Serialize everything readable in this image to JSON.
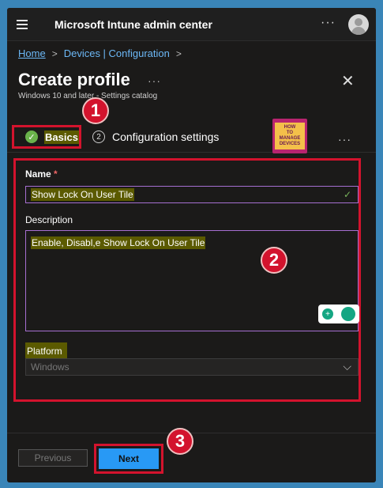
{
  "app": {
    "title": "Microsoft Intune admin center"
  },
  "breadcrumb": {
    "home": "Home",
    "item": "Devices | Configuration"
  },
  "page": {
    "title": "Create profile",
    "subtitle": "Windows 10 and later - Settings catalog"
  },
  "steps": [
    {
      "label": "Basics",
      "status": "complete"
    },
    {
      "number": "2",
      "label": "Configuration settings",
      "status": "pending"
    }
  ],
  "logo": {
    "lines": [
      "HOW",
      "TO",
      "MANAGE",
      "DEVICES"
    ]
  },
  "form": {
    "name": {
      "label": "Name",
      "required_mark": "*",
      "value": "Show Lock On User Tile"
    },
    "description": {
      "label": "Description",
      "value": "Enable, Disabl,e Show Lock On User Tile"
    },
    "platform": {
      "label": "Platform",
      "value": "Windows"
    }
  },
  "footer": {
    "previous_label": "Previous",
    "next_label": "Next"
  },
  "callouts": [
    "1",
    "2",
    "3"
  ],
  "colors": {
    "accent": "#2899f5",
    "highlight_border": "#d3132d",
    "success": "#6ab24b",
    "input_border": "#a66fd1"
  },
  "icons": [
    "hamburger-icon",
    "more-icon",
    "avatar-icon",
    "close-icon",
    "check-icon",
    "chevron-down-icon",
    "grammarly-icon"
  ]
}
